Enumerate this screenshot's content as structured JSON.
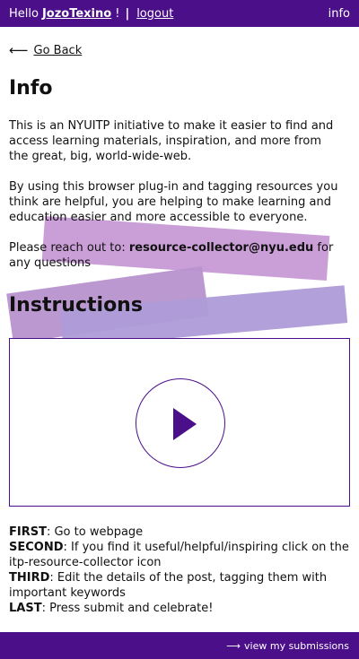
{
  "topbar": {
    "hello": "Hello",
    "username": "JozoTexino",
    "bang": "!",
    "separator": "|",
    "logout": "logout",
    "info": "info"
  },
  "nav": {
    "back_arrow": "⟵",
    "back_label": "Go Back"
  },
  "info": {
    "title": "Info",
    "p1": "This is an NYUITP initiative to make it easier to find and access learning materials, inspiration, and more from the great, big, world-wide-web.",
    "p2": "By using this browser plug-in and tagging resources you think are helpful, you are helping to make learning and education easier and more accessible to everyone.",
    "p3_prefix": "Please reach out to: ",
    "p3_email": "resource-collector@nyu.edu",
    "p3_suffix": " for any questions"
  },
  "instructions": {
    "title": "Instructions",
    "video_icon": "play-icon",
    "steps": [
      {
        "key": "FIRST",
        "text": ": Go to webpage"
      },
      {
        "key": "SECOND",
        "text": ": If you find it useful/helpful/inspiring click on the itp-resource-collector icon"
      },
      {
        "key": "THIRD",
        "text": ": Edit the details of the post, tagging them with important keywords"
      },
      {
        "key": "LAST",
        "text": ": Press submit and celebrate!"
      }
    ]
  },
  "footer": {
    "arrow": "⟶",
    "link": "view my submissions"
  },
  "colors": {
    "brand": "#4b0f8a",
    "shape1": "#c79ad5",
    "shape2": "#b892cf",
    "shape3": "#ad9bd8"
  }
}
